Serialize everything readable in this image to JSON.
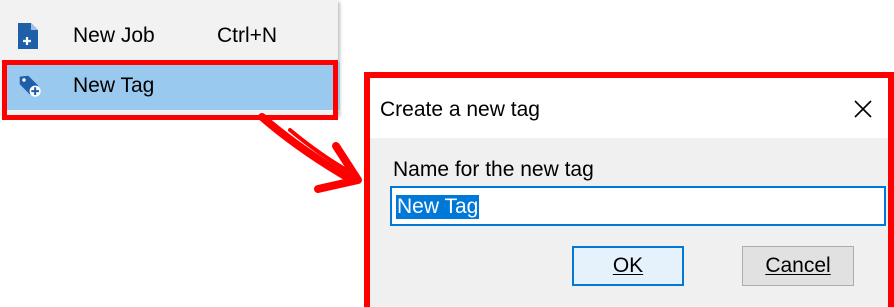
{
  "menu": {
    "items": [
      {
        "label": "New Job",
        "shortcut": "Ctrl+N",
        "icon": "new-document-icon"
      },
      {
        "label": "New Tag",
        "icon": "new-tag-icon"
      }
    ],
    "highlight_color": "#99c9ef"
  },
  "annotation": {
    "color": "#ff0000"
  },
  "dialog": {
    "title": "Create a new tag",
    "field_label": "Name for the new tag",
    "input_value": "New Tag",
    "ok_label": "OK",
    "cancel_label": "Cancel",
    "accent": "#0078d7"
  }
}
